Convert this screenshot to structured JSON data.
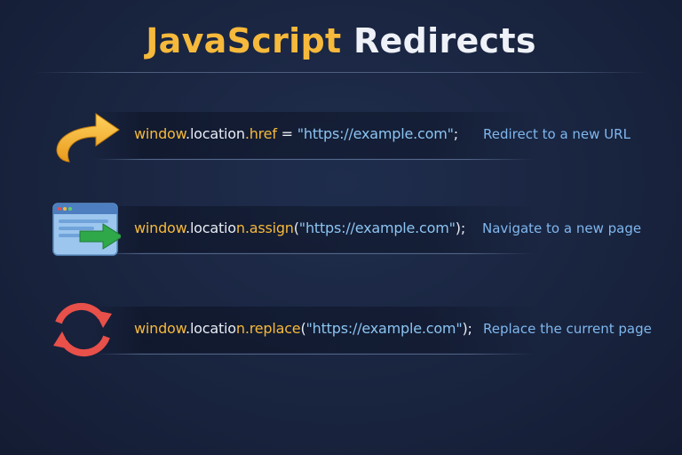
{
  "title": {
    "part1": "JavaScript",
    "part2": "Redirects"
  },
  "rows": [
    {
      "icon": "curved-arrow-icon",
      "code": {
        "obj": "window",
        "dot1": ".",
        "prop": "location",
        "dot2": ".",
        "method": "href",
        "mid": " = ",
        "str": "\"https://example.com\"",
        "end": ";"
      },
      "description": "Redirect to a new URL"
    },
    {
      "icon": "browser-arrow-icon",
      "code": {
        "obj": "window",
        "dot1": ".",
        "prop": "locatio",
        "dot2": "n.",
        "method": "assign",
        "mid": "(",
        "str": "\"https://example.com\"",
        "end": ");"
      },
      "description": "Navigate to a new page"
    },
    {
      "icon": "refresh-icon",
      "code": {
        "obj": "window",
        "dot1": ".",
        "prop": "locatio",
        "dot2": "n.",
        "method": "replace",
        "mid": "(",
        "str": "\"https://example.com\"",
        "end": ");"
      },
      "description": "Replace the current page"
    }
  ],
  "colors": {
    "accent": "#f6b93b",
    "text": "#e8ecf3",
    "string": "#8cc4f2",
    "description": "#7fb7ee",
    "background": "#19243f",
    "refresh": "#e8504a",
    "arrow_green": "#2fa84a"
  }
}
